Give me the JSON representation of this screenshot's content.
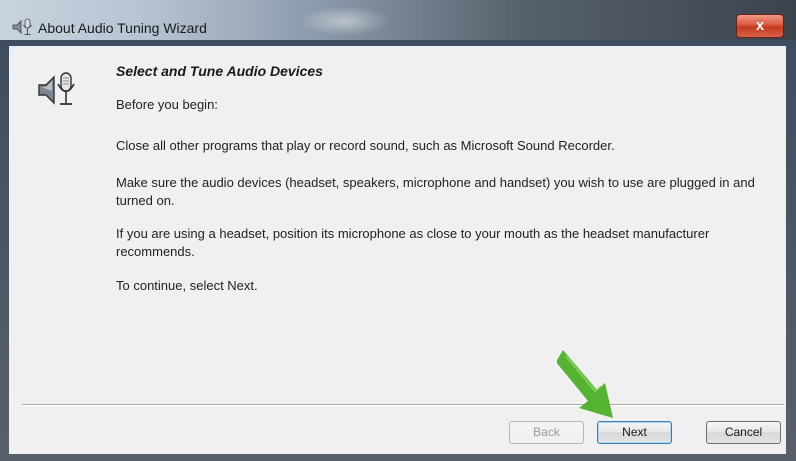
{
  "window": {
    "title": "About Audio Tuning Wizard",
    "close_label": "x"
  },
  "content": {
    "heading": "Select and Tune Audio Devices",
    "paragraphs": [
      "Before you begin:",
      "Close all other programs that play or record sound, such as Microsoft Sound Recorder.",
      "Make sure the audio devices (headset, speakers, microphone and handset) you wish to use are plugged in and turned on.",
      "If you are using a headset, position its microphone as close to your mouth as the headset manufacturer recommends.",
      "To continue, select Next."
    ]
  },
  "buttons": {
    "back": "Back",
    "next": "Next",
    "cancel": "Cancel"
  },
  "icons": {
    "title_icon": "speaker-microphone-icon",
    "wizard_icon": "speaker-microphone-icon",
    "annotation": "green-arrow-icon"
  },
  "colors": {
    "annotation_arrow": "#4caf27",
    "close_button": "#c4381f",
    "dialog_background": "#f0f0f0"
  }
}
